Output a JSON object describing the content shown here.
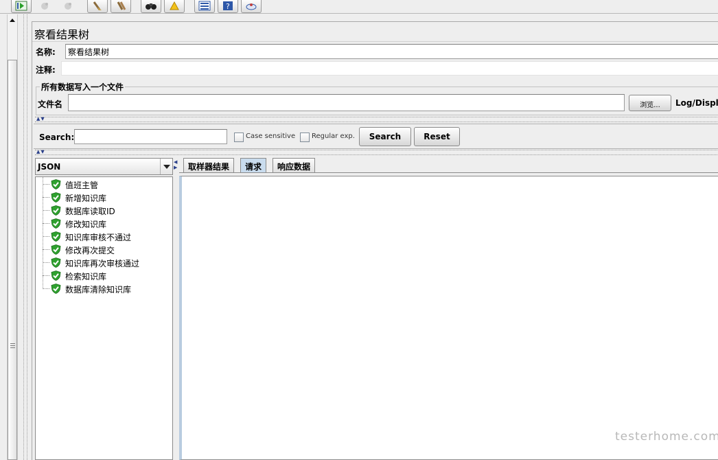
{
  "toolbar": {
    "buttons": [
      {
        "icon": "start-no-pause-icon",
        "enabled": true
      },
      {
        "icon": "stop-icon",
        "enabled": false
      },
      {
        "icon": "shutdown-icon",
        "enabled": false
      },
      {
        "icon": "clear-icon",
        "enabled": true
      },
      {
        "icon": "clear-all-icon",
        "enabled": true
      },
      {
        "icon": "search-binoculars-icon",
        "enabled": true
      },
      {
        "icon": "reset-search-broom-icon",
        "enabled": true
      },
      {
        "icon": "function-helper-icon",
        "enabled": true
      },
      {
        "icon": "help-icon",
        "enabled": true
      },
      {
        "icon": "remote-icon",
        "enabled": true
      }
    ]
  },
  "page": {
    "title": "察看结果树"
  },
  "form": {
    "name_label": "名称:",
    "name_value": "察看结果树",
    "comment_label": "注释:",
    "comment_value": ""
  },
  "file_group": {
    "legend": "所有数据写入一个文件",
    "filename_label": "文件名",
    "filename_value": "",
    "browse_label": "浏览...",
    "log_display_label": "Log/Display"
  },
  "search": {
    "label": "Search:",
    "value": "",
    "case_sensitive_label": "Case sensitive",
    "case_sensitive_checked": false,
    "regex_label": "Regular exp.",
    "regex_checked": false,
    "search_button": "Search",
    "reset_button": "Reset"
  },
  "renderer": {
    "selected": "JSON"
  },
  "tree": {
    "items": [
      {
        "label": "值班主管",
        "status": "success"
      },
      {
        "label": "新增知识库",
        "status": "success"
      },
      {
        "label": "数据库读取ID",
        "status": "success"
      },
      {
        "label": "修改知识库",
        "status": "success"
      },
      {
        "label": "知识库审核不通过",
        "status": "success"
      },
      {
        "label": "修改再次提交",
        "status": "success"
      },
      {
        "label": "知识库再次审核通过",
        "status": "success"
      },
      {
        "label": "检索知识库",
        "status": "success"
      },
      {
        "label": "数据库清除知识库",
        "status": "success"
      }
    ]
  },
  "tabs": [
    {
      "label": "取样器结果",
      "selected": false
    },
    {
      "label": "请求",
      "selected": true
    },
    {
      "label": "响应数据",
      "selected": false
    }
  ],
  "result": {
    "content": ""
  },
  "watermark": "testerhome.com",
  "colors": {
    "success": "#2fa12f",
    "selected_tab": "#c9dcee"
  }
}
